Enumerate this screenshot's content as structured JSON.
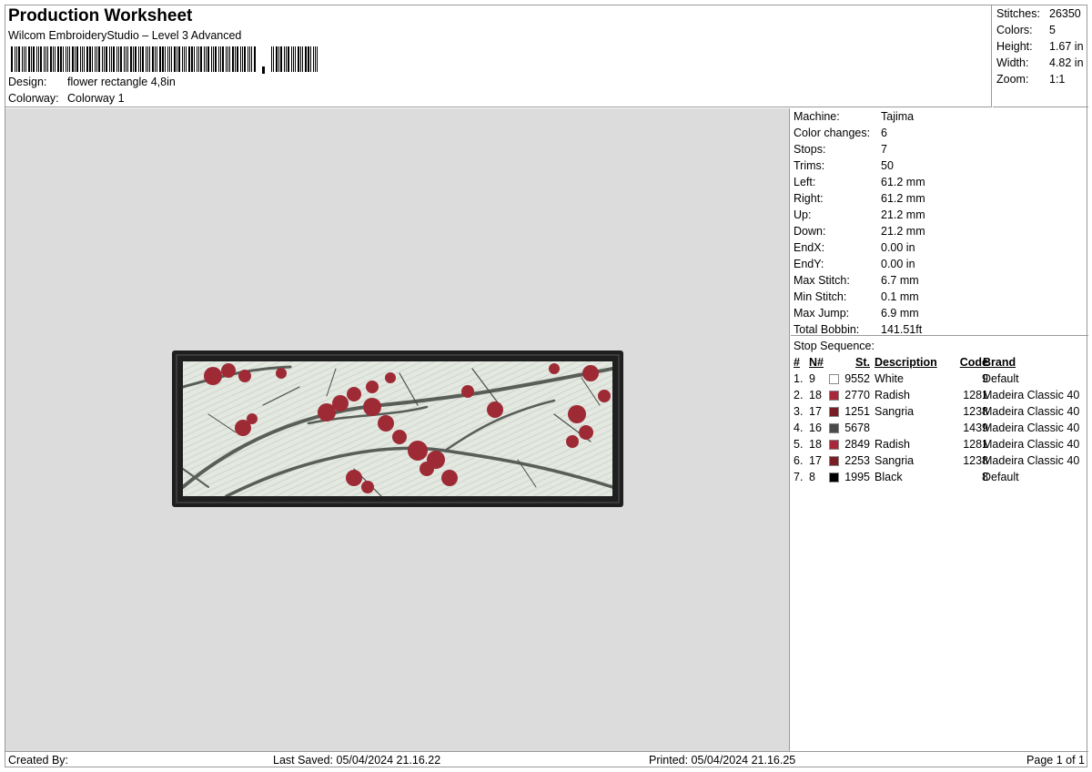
{
  "header": {
    "title": "Production Worksheet",
    "software": "Wilcom EmbroideryStudio – Level 3 Advanced",
    "design_label": "Design:",
    "design_value": "flower rectangle 4,8in",
    "colorway_label": "Colorway:",
    "colorway_value": "Colorway 1"
  },
  "summary": [
    {
      "label": "Stitches:",
      "value": "26350"
    },
    {
      "label": "Colors:",
      "value": "5"
    },
    {
      "label": "Height:",
      "value": "1.67 in"
    },
    {
      "label": "Width:",
      "value": "4.82 in"
    },
    {
      "label": "Zoom:",
      "value": "1:1"
    }
  ],
  "machine": [
    {
      "label": "Machine:",
      "value": "Tajima"
    },
    {
      "label": "Color changes:",
      "value": "6"
    },
    {
      "label": "Stops:",
      "value": "7"
    },
    {
      "label": "Trims:",
      "value": "50"
    },
    {
      "label": "Left:",
      "value": "61.2 mm"
    },
    {
      "label": "Right:",
      "value": "61.2 mm"
    },
    {
      "label": "Up:",
      "value": "21.2 mm"
    },
    {
      "label": "Down:",
      "value": "21.2 mm"
    },
    {
      "label": "EndX:",
      "value": "0.00 in"
    },
    {
      "label": "EndY:",
      "value": "0.00 in"
    },
    {
      "label": "Max Stitch:",
      "value": "6.7 mm"
    },
    {
      "label": "Min Stitch:",
      "value": "0.1 mm"
    },
    {
      "label": "Max Jump:",
      "value": "6.9 mm"
    },
    {
      "label": "Total Bobbin:",
      "value": "141.51ft"
    }
  ],
  "stop_sequence": {
    "title": "Stop Sequence:",
    "headers": {
      "num": "#",
      "n": "N#",
      "st": "St.",
      "desc": "Description",
      "code": "Code",
      "brand": "Brand"
    },
    "rows": [
      {
        "num": "1.",
        "n": "9",
        "color": "#ffffff",
        "st": "9552",
        "desc": "White",
        "code": "9",
        "brand": "Default"
      },
      {
        "num": "2.",
        "n": "18",
        "color": "#a8283a",
        "st": "2770",
        "desc": "Radish",
        "code": "1281",
        "brand": "Madeira Classic 40"
      },
      {
        "num": "3.",
        "n": "17",
        "color": "#7a1e26",
        "st": "1251",
        "desc": "Sangria",
        "code": "1238",
        "brand": "Madeira Classic 40"
      },
      {
        "num": "4.",
        "n": "16",
        "color": "#4a4a48",
        "st": "5678",
        "desc": "",
        "code": "1439",
        "brand": "Madeira Classic 40"
      },
      {
        "num": "5.",
        "n": "18",
        "color": "#a8283a",
        "st": "2849",
        "desc": "Radish",
        "code": "1281",
        "brand": "Madeira Classic 40"
      },
      {
        "num": "6.",
        "n": "17",
        "color": "#7a1e26",
        "st": "2253",
        "desc": "Sangria",
        "code": "1238",
        "brand": "Madeira Classic 40"
      },
      {
        "num": "7.",
        "n": "8",
        "color": "#000000",
        "st": "1995",
        "desc": "Black",
        "code": "8",
        "brand": "Default"
      }
    ]
  },
  "footer": {
    "created": "Created By:",
    "saved": "Last Saved: 05/04/2024 21.16.22",
    "printed": "Printed: 05/04/2024 21.16.25",
    "page": "Page 1 of 1"
  }
}
